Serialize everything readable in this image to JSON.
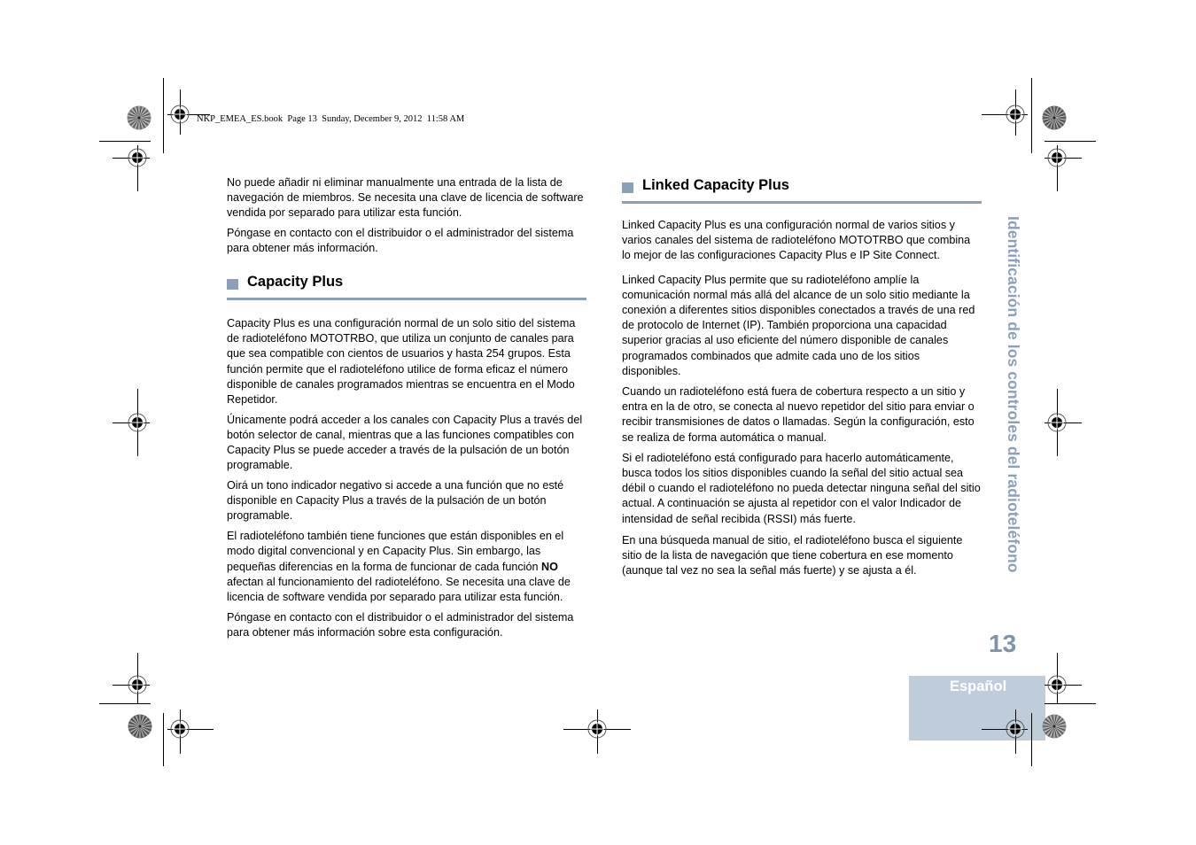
{
  "header": {
    "slug": "NKP_EMEA_ES.book  Page 13  Sunday, December 9, 2012  11:58 AM"
  },
  "left_column": {
    "intro_paragraphs": [
      "No puede añadir ni eliminar manualmente una entrada de la lista de navegación de miembros. Se necesita una clave de licencia de software vendida por separado para utilizar esta función.",
      "Póngase en contacto con el distribuidor o el administrador del sistema para obtener más información."
    ],
    "section": {
      "heading": "Capacity Plus",
      "paragraphs": [
        "Capacity Plus es una configuración normal de un solo sitio del sistema de radioteléfono MOTOTRBO, que utiliza un conjunto de canales para que sea compatible con cientos de usuarios y hasta 254 grupos. Esta función permite que el radioteléfono utilice de forma eficaz el número disponible de canales programados mientras se encuentra en el Modo Repetidor.",
        "Únicamente podrá acceder a los canales con Capacity Plus a través del botón selector de canal, mientras que a las funciones compatibles con Capacity Plus se puede acceder a través de la pulsación de un botón programable.",
        "Oirá un tono indicador negativo si accede a una función que no esté disponible en Capacity Plus a través de la pulsación de un botón programable."
      ],
      "para_with_bold": {
        "before": "El radioteléfono también tiene funciones que están disponibles en el modo digital convencional y en Capacity Plus. Sin embargo, las pequeñas diferencias en la forma de funcionar de cada función ",
        "bold": "NO",
        "after": " afectan al funcionamiento del radioteléfono. Se necesita una clave de licencia de software vendida por separado para utilizar esta función."
      },
      "closing": "Póngase en contacto con el distribuidor o el administrador del sistema para obtener más información sobre esta configuración."
    }
  },
  "right_column": {
    "section": {
      "heading": "Linked Capacity Plus",
      "paragraphs": [
        "Linked Capacity Plus es una configuración normal de varios sitios y varios canales del sistema de radioteléfono MOTOTRBO que combina lo mejor de las configuraciones Capacity Plus e IP Site Connect.",
        "Linked Capacity Plus permite que su radioteléfono amplíe la comunicación normal más allá del alcance de un solo sitio mediante la conexión a diferentes sitios disponibles conectados a través de una red de protocolo de Internet (IP). También proporciona una capacidad superior gracias al uso eficiente del número disponible de canales programados combinados que admite cada uno de los sitios disponibles.",
        "Cuando un radioteléfono está fuera de cobertura respecto a un sitio y entra en la de otro, se conecta al nuevo repetidor del sitio para enviar o recibir transmisiones de datos o llamadas. Según la configuración, esto se realiza de forma automática o manual.",
        "Si el radioteléfono está configurado para hacerlo automáticamente, busca todos los sitios disponibles cuando la señal del sitio actual sea débil o cuando el radioteléfono no pueda detectar ninguna señal del sitio actual. A continuación se ajusta al repetidor con el valor Indicador de intensidad de señal recibida (RSSI) más fuerte.",
        "En una búsqueda manual de sitio, el radioteléfono busca el siguiente sitio de la lista de navegación que tiene cobertura en ese momento (aunque tal vez no sea la señal más fuerte) y se ajusta a él."
      ]
    }
  },
  "side_tab": {
    "chapter_title": "Identificación de los controles del radioteléfono",
    "page_number": "13",
    "language": "Español"
  },
  "colors": {
    "accent": "#8aa0b8",
    "page_number": "#7d94ad",
    "language_tab_bg": "#bfcddb",
    "language_tab_text": "#ffffff"
  }
}
